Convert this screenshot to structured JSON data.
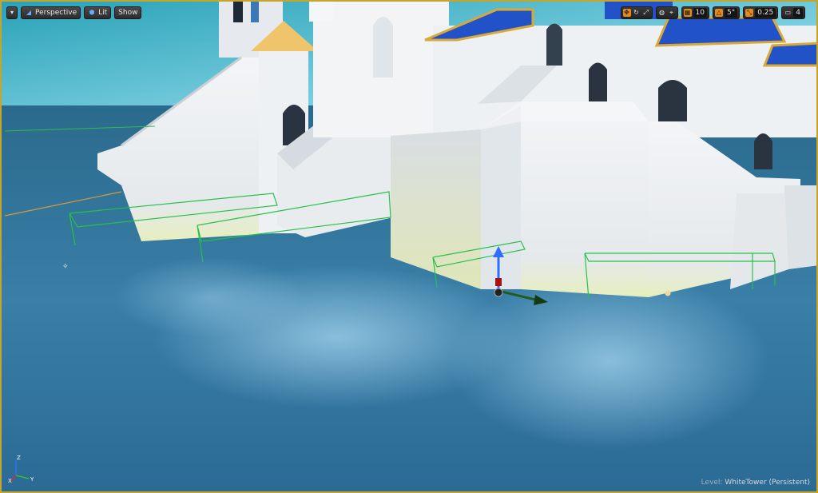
{
  "toolbar_left": {
    "view_mode_label": "Perspective",
    "lit_label": "Lit",
    "show_label": "Show"
  },
  "toolbar_right": {
    "grid_snap_value": "10",
    "rotation_snap_value": "5°",
    "scale_snap_value": "0.25",
    "camera_speed_value": "4"
  },
  "status": {
    "level_prefix": "Level:",
    "level_name": "WhiteTower (Persistent)"
  },
  "axes_labels": {
    "x": "X",
    "y": "Y",
    "z": "Z"
  },
  "icons": [
    "viewport-menu-icon",
    "perspective-icon",
    "lit-sphere-icon",
    "translate-mode-icon",
    "rotate-mode-icon",
    "scale-mode-icon",
    "world-local-icon",
    "surface-snap-icon",
    "grid-snap-icon",
    "rotation-snap-icon",
    "scale-snap-icon",
    "camera-speed-icon",
    "move-gizmo-icon"
  ],
  "colors": {
    "viewport_border": "#c7a52a",
    "water": "#2f6d96",
    "wall": "#eceff1",
    "roof_blue": "#2152c8",
    "roof_trim": "#d8a93a",
    "volume_green": "#27c14a",
    "toolbar_active": "#e38a1b"
  }
}
